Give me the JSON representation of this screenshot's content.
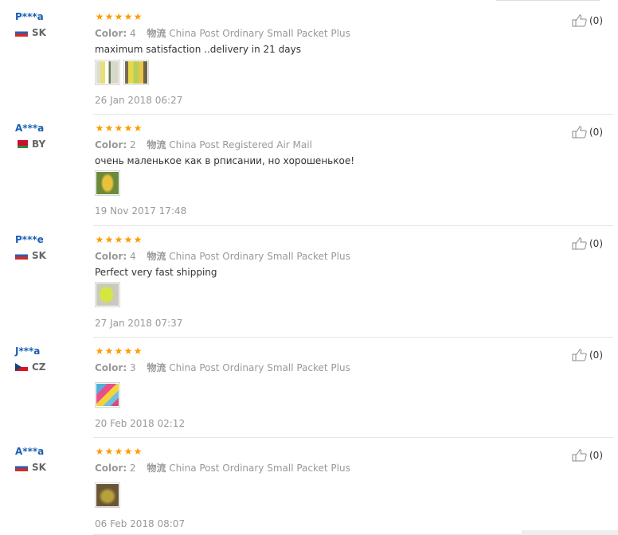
{
  "reviews": [
    {
      "user": "P***a",
      "country": "SK",
      "flag": "slovakia-flag-icon",
      "stars": [
        "★",
        "★",
        "★",
        "★",
        "★"
      ],
      "color_label": "Color:",
      "color_value": "4",
      "logistics_label": "物流",
      "logistics_value": "China Post Ordinary Small Packet Plus",
      "text": "maximum satisfaction ..delivery in 21 days",
      "images": [
        "review-photo-white-yellow-items",
        "review-photo-yellow-green-items"
      ],
      "date": "26 Jan 2018 06:27",
      "helpful_count": "(0)"
    },
    {
      "user": "A***a",
      "country": "BY",
      "flag": "belarus-flag-icon",
      "stars": [
        "★",
        "★",
        "★",
        "★",
        "★"
      ],
      "color_label": "Color:",
      "color_value": "2",
      "logistics_label": "物流",
      "logistics_value": "China Post Registered Air Mail",
      "text": "очень маленькое как в рписании, но хорошенькое!",
      "images": [
        "review-photo-yellow-item"
      ],
      "date": "19 Nov 2017 17:48",
      "helpful_count": "(0)"
    },
    {
      "user": "P***e",
      "country": "SK",
      "flag": "slovakia-flag-icon",
      "stars": [
        "★",
        "★",
        "★",
        "★",
        "★"
      ],
      "color_label": "Color:",
      "color_value": "4",
      "logistics_label": "物流",
      "logistics_value": "China Post Ordinary Small Packet Plus",
      "text": "Perfect very fast shipping",
      "images": [
        "review-photo-lime-item"
      ],
      "date": "27 Jan 2018 07:37",
      "helpful_count": "(0)"
    },
    {
      "user": "J***a",
      "country": "CZ",
      "flag": "czech-flag-icon",
      "stars": [
        "★",
        "★",
        "★",
        "★",
        "★"
      ],
      "color_label": "Color:",
      "color_value": "3",
      "logistics_label": "物流",
      "logistics_value": "China Post Ordinary Small Packet Plus",
      "text": "",
      "images": [
        "review-photo-colorful-items"
      ],
      "date": "20 Feb 2018 02:12",
      "helpful_count": "(0)"
    },
    {
      "user": "A***a",
      "country": "SK",
      "flag": "slovakia-flag-icon",
      "stars": [
        "★",
        "★",
        "★",
        "★",
        "★"
      ],
      "color_label": "Color:",
      "color_value": "2",
      "logistics_label": "物流",
      "logistics_value": "China Post Ordinary Small Packet Plus",
      "text": "",
      "images": [
        "review-photo-brown-item"
      ],
      "date": "06 Feb 2018 08:07",
      "helpful_count": "(0)"
    }
  ],
  "colors": {
    "username": "#1a5fb4",
    "star": "#ff9a00",
    "muted": "#999999",
    "body_text": "#333333"
  },
  "icons": {
    "helpful": "thumbs-up-icon"
  }
}
